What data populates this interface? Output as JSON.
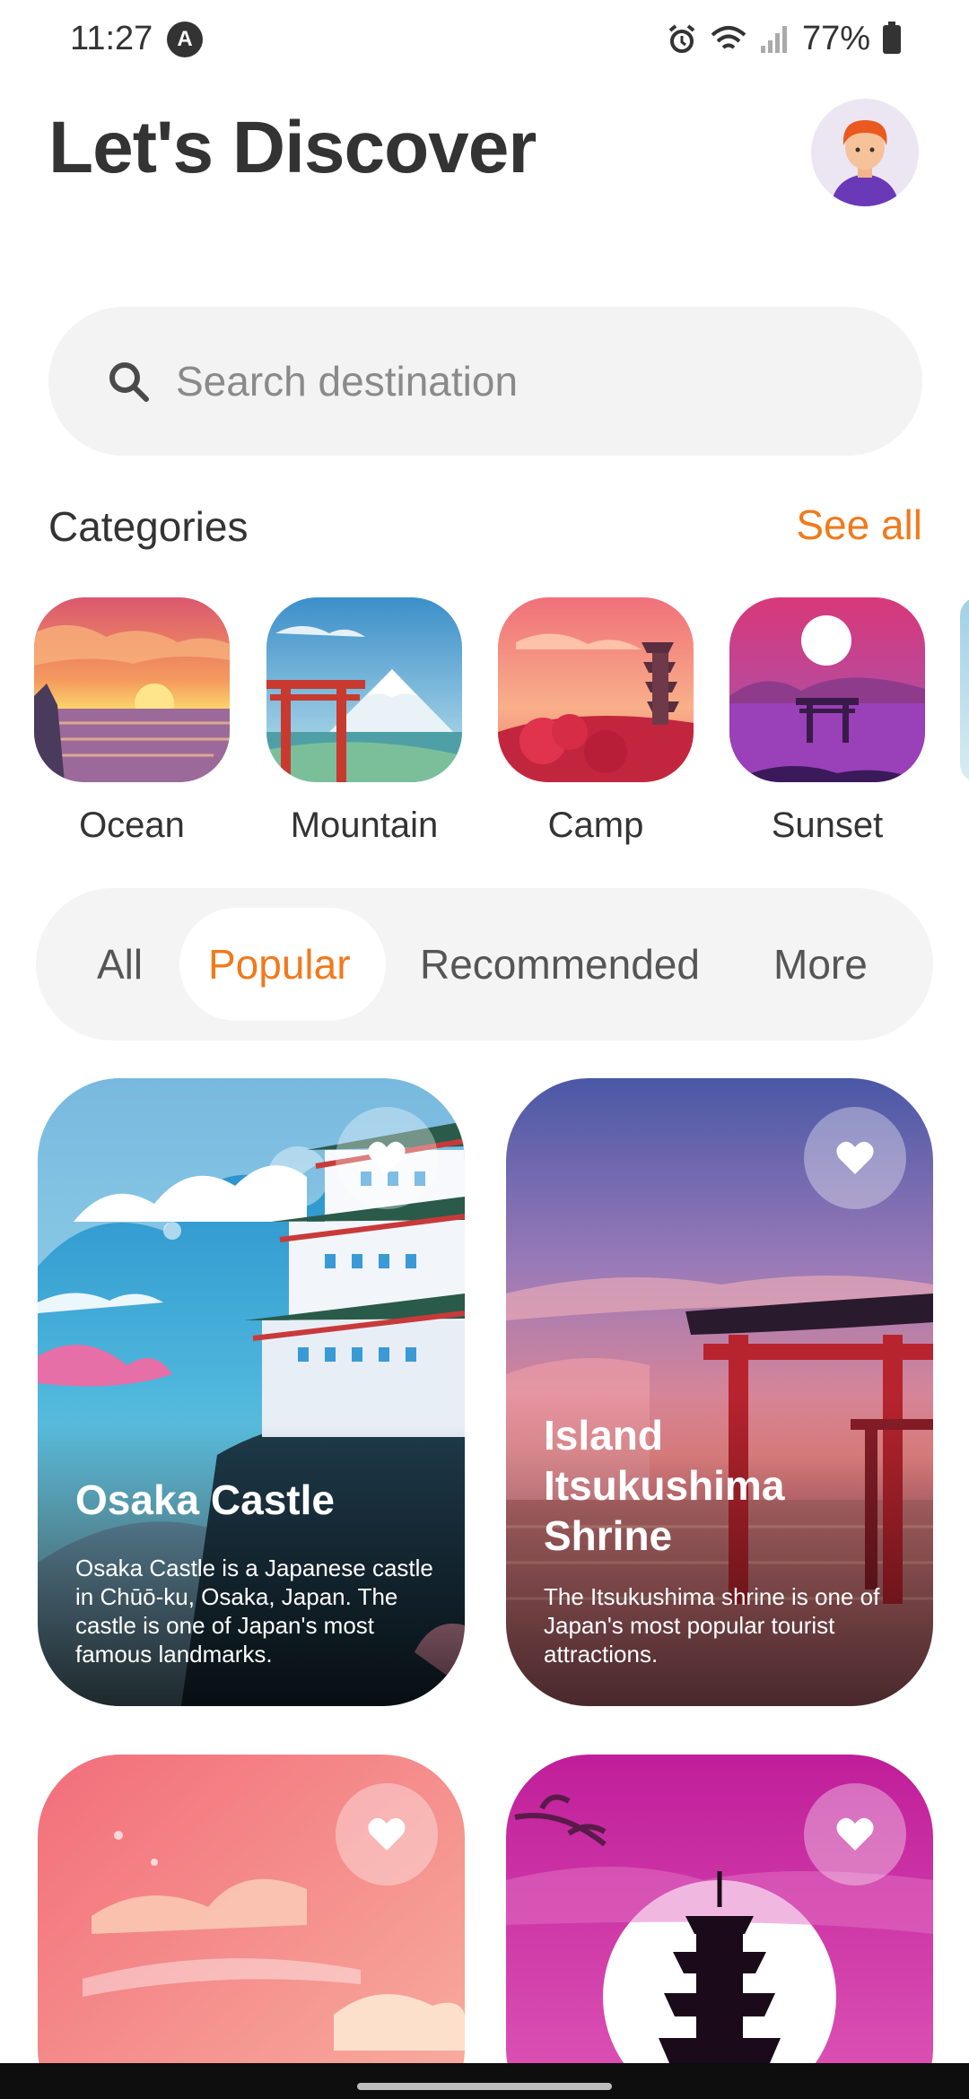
{
  "status": {
    "time": "11:27",
    "a_badge": "A",
    "battery": "77%"
  },
  "header": {
    "title": "Let's Discover"
  },
  "search": {
    "placeholder": "Search destination"
  },
  "categories": {
    "title": "Categories",
    "see_all": "See all",
    "items": [
      {
        "label": "Ocean"
      },
      {
        "label": "Mountain"
      },
      {
        "label": "Camp"
      },
      {
        "label": "Sunset"
      }
    ]
  },
  "tabs": {
    "items": [
      "All",
      "Popular",
      "Recommended",
      "More"
    ],
    "active": "Popular"
  },
  "cards": [
    {
      "title": "Osaka Castle",
      "description": "Osaka Castle is a Japanese castle in Chūō-ku, Osaka, Japan. The castle is one of Japan's most famous landmarks."
    },
    {
      "title_lines": [
        "Island",
        "Itsukushima",
        "Shrine"
      ],
      "description": "The Itsukushima shrine is one of Japan's most popular tourist attractions."
    }
  ],
  "colors": {
    "accent": "#f07a1c",
    "text": "#333333",
    "surface": "#f3f3f3"
  }
}
